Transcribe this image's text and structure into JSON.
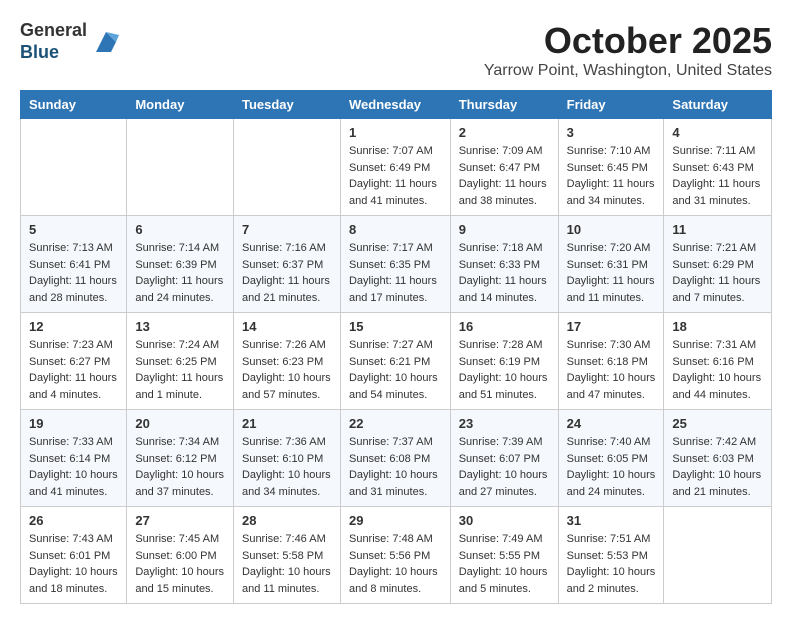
{
  "header": {
    "logo_general": "General",
    "logo_blue": "Blue",
    "month_title": "October 2025",
    "location": "Yarrow Point, Washington, United States"
  },
  "calendar": {
    "days_of_week": [
      "Sunday",
      "Monday",
      "Tuesday",
      "Wednesday",
      "Thursday",
      "Friday",
      "Saturday"
    ],
    "weeks": [
      [
        {
          "day": "",
          "sunrise": "",
          "sunset": "",
          "daylight": ""
        },
        {
          "day": "",
          "sunrise": "",
          "sunset": "",
          "daylight": ""
        },
        {
          "day": "",
          "sunrise": "",
          "sunset": "",
          "daylight": ""
        },
        {
          "day": "1",
          "sunrise": "Sunrise: 7:07 AM",
          "sunset": "Sunset: 6:49 PM",
          "daylight": "Daylight: 11 hours and 41 minutes."
        },
        {
          "day": "2",
          "sunrise": "Sunrise: 7:09 AM",
          "sunset": "Sunset: 6:47 PM",
          "daylight": "Daylight: 11 hours and 38 minutes."
        },
        {
          "day": "3",
          "sunrise": "Sunrise: 7:10 AM",
          "sunset": "Sunset: 6:45 PM",
          "daylight": "Daylight: 11 hours and 34 minutes."
        },
        {
          "day": "4",
          "sunrise": "Sunrise: 7:11 AM",
          "sunset": "Sunset: 6:43 PM",
          "daylight": "Daylight: 11 hours and 31 minutes."
        }
      ],
      [
        {
          "day": "5",
          "sunrise": "Sunrise: 7:13 AM",
          "sunset": "Sunset: 6:41 PM",
          "daylight": "Daylight: 11 hours and 28 minutes."
        },
        {
          "day": "6",
          "sunrise": "Sunrise: 7:14 AM",
          "sunset": "Sunset: 6:39 PM",
          "daylight": "Daylight: 11 hours and 24 minutes."
        },
        {
          "day": "7",
          "sunrise": "Sunrise: 7:16 AM",
          "sunset": "Sunset: 6:37 PM",
          "daylight": "Daylight: 11 hours and 21 minutes."
        },
        {
          "day": "8",
          "sunrise": "Sunrise: 7:17 AM",
          "sunset": "Sunset: 6:35 PM",
          "daylight": "Daylight: 11 hours and 17 minutes."
        },
        {
          "day": "9",
          "sunrise": "Sunrise: 7:18 AM",
          "sunset": "Sunset: 6:33 PM",
          "daylight": "Daylight: 11 hours and 14 minutes."
        },
        {
          "day": "10",
          "sunrise": "Sunrise: 7:20 AM",
          "sunset": "Sunset: 6:31 PM",
          "daylight": "Daylight: 11 hours and 11 minutes."
        },
        {
          "day": "11",
          "sunrise": "Sunrise: 7:21 AM",
          "sunset": "Sunset: 6:29 PM",
          "daylight": "Daylight: 11 hours and 7 minutes."
        }
      ],
      [
        {
          "day": "12",
          "sunrise": "Sunrise: 7:23 AM",
          "sunset": "Sunset: 6:27 PM",
          "daylight": "Daylight: 11 hours and 4 minutes."
        },
        {
          "day": "13",
          "sunrise": "Sunrise: 7:24 AM",
          "sunset": "Sunset: 6:25 PM",
          "daylight": "Daylight: 11 hours and 1 minute."
        },
        {
          "day": "14",
          "sunrise": "Sunrise: 7:26 AM",
          "sunset": "Sunset: 6:23 PM",
          "daylight": "Daylight: 10 hours and 57 minutes."
        },
        {
          "day": "15",
          "sunrise": "Sunrise: 7:27 AM",
          "sunset": "Sunset: 6:21 PM",
          "daylight": "Daylight: 10 hours and 54 minutes."
        },
        {
          "day": "16",
          "sunrise": "Sunrise: 7:28 AM",
          "sunset": "Sunset: 6:19 PM",
          "daylight": "Daylight: 10 hours and 51 minutes."
        },
        {
          "day": "17",
          "sunrise": "Sunrise: 7:30 AM",
          "sunset": "Sunset: 6:18 PM",
          "daylight": "Daylight: 10 hours and 47 minutes."
        },
        {
          "day": "18",
          "sunrise": "Sunrise: 7:31 AM",
          "sunset": "Sunset: 6:16 PM",
          "daylight": "Daylight: 10 hours and 44 minutes."
        }
      ],
      [
        {
          "day": "19",
          "sunrise": "Sunrise: 7:33 AM",
          "sunset": "Sunset: 6:14 PM",
          "daylight": "Daylight: 10 hours and 41 minutes."
        },
        {
          "day": "20",
          "sunrise": "Sunrise: 7:34 AM",
          "sunset": "Sunset: 6:12 PM",
          "daylight": "Daylight: 10 hours and 37 minutes."
        },
        {
          "day": "21",
          "sunrise": "Sunrise: 7:36 AM",
          "sunset": "Sunset: 6:10 PM",
          "daylight": "Daylight: 10 hours and 34 minutes."
        },
        {
          "day": "22",
          "sunrise": "Sunrise: 7:37 AM",
          "sunset": "Sunset: 6:08 PM",
          "daylight": "Daylight: 10 hours and 31 minutes."
        },
        {
          "day": "23",
          "sunrise": "Sunrise: 7:39 AM",
          "sunset": "Sunset: 6:07 PM",
          "daylight": "Daylight: 10 hours and 27 minutes."
        },
        {
          "day": "24",
          "sunrise": "Sunrise: 7:40 AM",
          "sunset": "Sunset: 6:05 PM",
          "daylight": "Daylight: 10 hours and 24 minutes."
        },
        {
          "day": "25",
          "sunrise": "Sunrise: 7:42 AM",
          "sunset": "Sunset: 6:03 PM",
          "daylight": "Daylight: 10 hours and 21 minutes."
        }
      ],
      [
        {
          "day": "26",
          "sunrise": "Sunrise: 7:43 AM",
          "sunset": "Sunset: 6:01 PM",
          "daylight": "Daylight: 10 hours and 18 minutes."
        },
        {
          "day": "27",
          "sunrise": "Sunrise: 7:45 AM",
          "sunset": "Sunset: 6:00 PM",
          "daylight": "Daylight: 10 hours and 15 minutes."
        },
        {
          "day": "28",
          "sunrise": "Sunrise: 7:46 AM",
          "sunset": "Sunset: 5:58 PM",
          "daylight": "Daylight: 10 hours and 11 minutes."
        },
        {
          "day": "29",
          "sunrise": "Sunrise: 7:48 AM",
          "sunset": "Sunset: 5:56 PM",
          "daylight": "Daylight: 10 hours and 8 minutes."
        },
        {
          "day": "30",
          "sunrise": "Sunrise: 7:49 AM",
          "sunset": "Sunset: 5:55 PM",
          "daylight": "Daylight: 10 hours and 5 minutes."
        },
        {
          "day": "31",
          "sunrise": "Sunrise: 7:51 AM",
          "sunset": "Sunset: 5:53 PM",
          "daylight": "Daylight: 10 hours and 2 minutes."
        },
        {
          "day": "",
          "sunrise": "",
          "sunset": "",
          "daylight": ""
        }
      ]
    ]
  }
}
